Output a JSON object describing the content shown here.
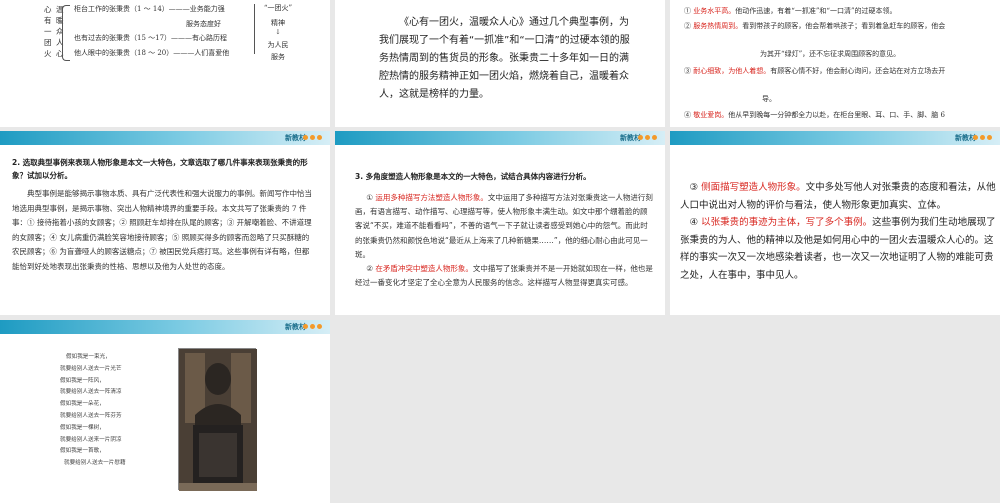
{
  "header": {
    "label": "新教材"
  },
  "slide1": {
    "vertical_cols": [
      "心有一团火",
      "温暖众人心"
    ],
    "rows": [
      "柜台工作的张秉贵（1 ～ 14）———业务能力强",
      "　　　　　　　　　　　　　　　　服务态度好",
      "也有过去的张秉贵（15 ～17）———有心路历程",
      "他人眼中的张秉贵（18 ～ 20）———人们喜爱他"
    ],
    "note_top": "“一团火”",
    "note_mid": "精神",
    "note_arrow": "↓",
    "note_bottom1": "为人民",
    "note_bottom2": "服务"
  },
  "slide2": {
    "text": "《心有一团火，温暖众人心》通过几个典型事例，为我们展现了一个有着“一抓准”和“一口清”的过硬本领的服务热情周到的售货员的形象。张秉贵二十多年如一日的满腔热情的服务精神正如一团火焰，燃烧着自己，温暖着众人，这就是榜样的力量。"
  },
  "slide3": {
    "l1_num": "①",
    "l1_red": "业务水平高。",
    "l1_rest": "他动作迅速，有着“一抓准”和“一口清”的过硬本领。",
    "l2_num": "②",
    "l2_red": "服务热情周到。",
    "l2_rest": "看到带孩子的顾客，他会帮着哄孩子；看到着急赶车的顾客，他会",
    "l3": "为其开“绿灯”，还不忘征求周围顾客的意见。",
    "l4_num": "③",
    "l4_red": "耐心细致，为他人着想。",
    "l4_rest": "有顾客心情不好，他会耐心询问，还会站在对方立场去开",
    "l5": "导。",
    "l6_num": "④",
    "l6_red": "敬业爱岗。",
    "l6_rest": "他从早到晚每一分钟都全力以赴，在柜台里眼、耳、口、手、脚、脑 6"
  },
  "slide4": {
    "question": "2. 选取典型事例来表现人物形象是本文一大特色，文章选取了哪几件事来表现张秉贵的形象？试加以分析。",
    "answer": "典型事例是能够揭示事物本质、具有广泛代表性和强大说服力的事例。新闻写作中恰当地选用典型事例，是揭示事物、突出人物精神境界的重要手段。本文共写了张秉贵的 7 件事：① 接待拖着小孩的女顾客；② 照顾赶车却排在队尾的顾客；③ 开解嘲着脸、不讲道理的女顾客；④ 女儿病重仍满脸笑容地接待顾客；⑤ 照顾买得多的顾客而忽略了只买酥糖的农民顾客；⑥ 为盲聋哑人的顾客送糖点；⑦ 被国民党兵痞打骂。这些事例有详有略，但都能恰到好处地表现出张秉贵的性格、思想以及他为人处世的态度。"
  },
  "slide5": {
    "question": "3. 多角度塑造人物形象是本文的一大特色，试结合具体内容进行分析。",
    "p1_num": "①",
    "p1_red": "运用多种描写方法塑造人物形象。",
    "p1_rest": "文中运用了多种描写方法对张秉贵这一人物进行刻画，有语言描写、动作描写、心理描写等，使人物形象丰满生动。如文中那个绷着脸的顾客说“不买，难道不能看看吗”，不善的语气一下子就让读者感受到她心中的怨气。而此时的张秉贵仍然和颜悦色地说“最近从上海来了几种新糖果……”，他的细心耐心由此可见一斑。",
    "p2_num": "②",
    "p2_red": "在矛盾冲突中塑造人物形象。",
    "p2_rest": "文中描写了张秉贵并不是一开始就如现在一样，他也是经过一番变化才坚定了全心全意为人民服务的信念。这样描写人物显得更真实可感。"
  },
  "slide6": {
    "p1_num": "③",
    "p1_red": "侧面描写塑造人物形象。",
    "p1_rest": "文中多处写他人对张秉贵的态度和看法，从他人口中说出对人物的评价与看法，使人物形象更加真实、立体。",
    "p2_num": "④",
    "p2_red": "以张秉贵的事迹为主体，写了多个事例。",
    "p2_rest": "这些事例为我们生动地展现了张秉贵的为人、他的精神以及他是如何用心中的一团火去温暖众人心的。这样的事实一次又一次地感染着读者，也一次又一次地证明了人物的难能可贵之处，人在事中，事中见人。"
  },
  "slide7": {
    "poem": [
      "假如我是一束光，",
      "就要给别人送去一片光芒",
      "假如我是一阵风，",
      "就要给别人送去一阵清凉",
      "假如我是一朵花，",
      "就要给别人送去一阵芬芳",
      "假如我是一棵树，",
      "就要给别人送来一片阴凉",
      "假如我是一首歌，",
      "就要给别人送去一片慰藉"
    ]
  }
}
